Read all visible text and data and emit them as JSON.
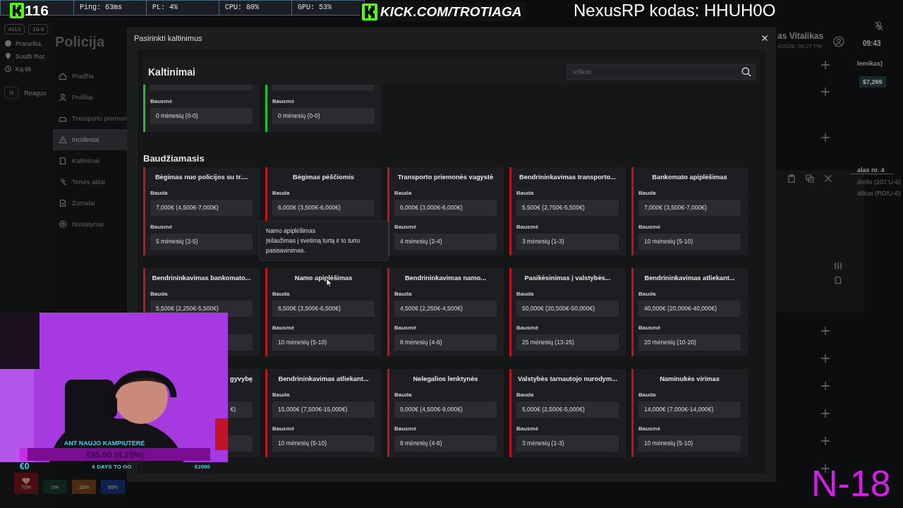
{
  "stream_overlay": {
    "viewer_count": "116",
    "stats_bar": [
      {
        "text": "Ping: 63ms"
      },
      {
        "text": "PL: 4%"
      },
      {
        "text": "CPU: 80%"
      },
      {
        "text": "GPU: 53%"
      }
    ],
    "channel": "KICK.COM/TROTIAGA",
    "promo": "NexusRP kodas: HHUH0O",
    "age_rating": "N-18",
    "goal": {
      "title": "ANT NAUJO KAMPIUTERE",
      "amount": "€85.00 (4.25%)",
      "level": 0.0425,
      "start": "€0",
      "remaining": "6 DAYS TO GO",
      "target": "€2000"
    },
    "status_meters": [
      {
        "value": "70%",
        "color": "#4a0d12"
      },
      {
        "value": "0%",
        "color": "#0e241c"
      },
      {
        "value": "33%",
        "color": "#4a2a12"
      },
      {
        "value": "89%",
        "color": "#0f1f4f"
      }
    ]
  },
  "background_app": {
    "badges": [
      "#113",
      "10-9"
    ],
    "call_info": [
      "Pranešta,",
      "South Roc",
      "Ką tik"
    ],
    "unit": {
      "letter": "G",
      "status": "Reaguo"
    },
    "title": "Policija",
    "nav_items": [
      {
        "label": "Pradžia",
        "selected": false
      },
      {
        "label": "Profiliai",
        "selected": false
      },
      {
        "label": "Transporto priemon",
        "selected": false
      },
      {
        "label": "Incidentai",
        "selected": true
      },
      {
        "label": "Kaltinimai",
        "selected": false
      },
      {
        "label": "Teisės aktai",
        "selected": false
      },
      {
        "label": "Žurnalai",
        "selected": false
      },
      {
        "label": "Nustatymai",
        "selected": false
      }
    ],
    "officer_name": "as Vitalikas",
    "officer_date": "4/2026, 09:27 PM",
    "clock": "09:43",
    "role": "lemikas)",
    "balance": "$7,269",
    "report_title": "alas nr. 4",
    "report_lines": [
      "drelis (207 U-6)",
      "alikas (RD/U-6)"
    ]
  },
  "modal": {
    "title": "Pasirinkti kaltinimus",
    "heading": "Kaltinimai",
    "search": {
      "placeholder": "Ieškoti"
    },
    "tooltip": {
      "title": "Namo apiplėšimas",
      "text": "Įsilaužimas į svetimą turtą ir to turto pasisavinimas."
    },
    "sections": [
      {
        "color": "#22c02a",
        "cards": [
          {
            "sentence_label": "Bausmė",
            "sentence": "0 mėnesių (0-0)"
          },
          {
            "sentence_label": "Bausmė",
            "sentence": "0 mėnesių (0-0)"
          }
        ]
      },
      {
        "title": "Baudžiamasis",
        "color": "#c0141c",
        "cards": [
          {
            "title": "Bėgimas nuo policijos su tr....",
            "fine_label": "Bauda",
            "fine": "7,000€ (4,500€-7,000€)",
            "sentence_label": "Bausmė",
            "sentence": "5 mėnesių (2-5)"
          },
          {
            "title": "Bėgimas pėščiomis",
            "fine_label": "Bauda",
            "fine": "6,000€ (3,500€-6,000€)"
          },
          {
            "title": "Transporto priemonės vagystė",
            "fine_label": "Bauda",
            "fine": "6,000€ (3,000€-6,000€)",
            "sentence_label": "Bausmė",
            "sentence": "4 mėnesių (2-4)"
          },
          {
            "title": "Bendrininkavimas transporto...",
            "fine_label": "Bauda",
            "fine": "5,500€ (2,750€-5,500€)",
            "sentence_label": "Bausmė",
            "sentence": "3 mėnesių (1-3)"
          },
          {
            "title": "Bankomato apiplėšimas",
            "fine_label": "Bauda",
            "fine": "7,000€ (3,500€-7,000€)",
            "sentence_label": "Bausmė",
            "sentence": "10 mėnesių (5-10)"
          },
          {
            "title": "Bendrininkavimas bankomato...",
            "fine_label": "Bauda",
            "fine": "5,500€ (2,250€-5,500€)"
          },
          {
            "title": "Namo apiplėšimas",
            "fine_label": "Bauda",
            "fine": "6,500€ (3,500€-6,500€)",
            "sentence_label": "Bausmė",
            "sentence": "10 mėnesių (5-10)"
          },
          {
            "title": "Bendrininkavimas namo...",
            "fine_label": "Bauda",
            "fine": "4,500€ (2,250€-4,500€)",
            "sentence_label": "Bausmė",
            "sentence": "8 mėnesių (4-8)"
          },
          {
            "title": "Pasikėsinimas į valstybės...",
            "fine_label": "Bauda",
            "fine": "50,000€ (20,500€-50,000€)",
            "sentence_label": "Bausmė",
            "sentence": "25 mėnesių (13-25)"
          },
          {
            "title": "Bendrininkavimas atliekant...",
            "fine_label": "Bauda",
            "fine": "40,000€ (20,000€-40,000€)",
            "sentence_label": "Bausmė",
            "sentence": "20 mėnesių (10-20)"
          },
          {
            "title": "gyvybę",
            "fine": "€)",
            "clipped": true
          },
          {
            "title": "Bendrininkavimas atliekant...",
            "fine_label": "Bauda",
            "fine": "15,000€ (7,500€-15,000€)",
            "sentence_label": "Bausmė",
            "sentence": "10 mėnesių (5-10)"
          },
          {
            "title": "Nelegalios lenktynės",
            "fine_label": "Bauda",
            "fine": "9,000€ (4,500€-9,000€)",
            "sentence_label": "Bausmė",
            "sentence": "8 mėnesių (4-8)"
          },
          {
            "title": "Valstybės tarnautojo nurodym...",
            "fine_label": "Bauda",
            "fine": "5,000€ (2,500€-5,000€)",
            "sentence_label": "Bausmė",
            "sentence": "3 mėnesių (1-3)"
          },
          {
            "title": "Naminukės virimas",
            "fine_label": "Bauda",
            "fine": "14,000€ (7,000€-14,000€)",
            "sentence_label": "Bausmė",
            "sentence": "10 mėnesių (5-10)"
          }
        ]
      }
    ]
  }
}
